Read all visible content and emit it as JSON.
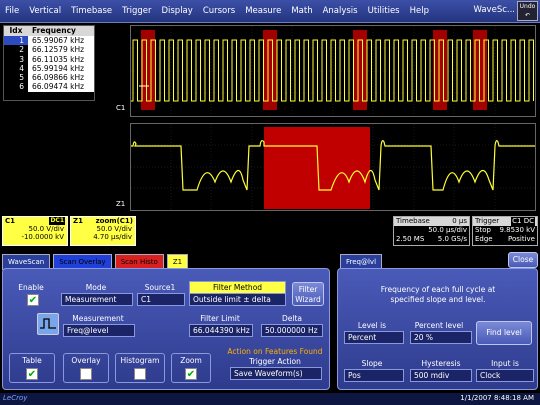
{
  "menu": {
    "items": [
      "File",
      "Vertical",
      "Timebase",
      "Trigger",
      "Display",
      "Cursors",
      "Measure",
      "Math",
      "Analysis",
      "Utilities",
      "Help"
    ],
    "brand": "WaveSc...",
    "undo_label": "Undo"
  },
  "freq_table": {
    "headers": {
      "idx": "Idx",
      "freq": "Frequency"
    },
    "rows": [
      {
        "idx": "1",
        "freq": "65.99067 kHz"
      },
      {
        "idx": "2",
        "freq": "66.12579 kHz"
      },
      {
        "idx": "3",
        "freq": "66.11035 kHz"
      },
      {
        "idx": "4",
        "freq": "65.99194 kHz"
      },
      {
        "idx": "5",
        "freq": "66.09866 kHz"
      },
      {
        "idx": "6",
        "freq": "66.09474 kHz"
      }
    ]
  },
  "traces": {
    "c1_label": "C1",
    "z1_label": "Z1"
  },
  "c1_box": {
    "title": "C1",
    "badge": "DC1",
    "line1": "50.0 V/div",
    "line2": "-10.0000 kV"
  },
  "z1_box": {
    "title": "Z1",
    "name": "zoom(C1)",
    "line1": "50.0 V/div",
    "line2": "4.70 µs/div"
  },
  "timebase_box": {
    "title": "Timebase",
    "delay": "0 µs",
    "line1_left": "",
    "line1_right": "50.0 µs/div",
    "line2_left": "2.50 MS",
    "line2_right": "5.0 GS/s"
  },
  "trigger_box": {
    "title": "Trigger",
    "badge": "C1 DC",
    "line1_left": "Stop",
    "line1_right": "9.8530 kV",
    "line2_left": "Edge",
    "line2_right": "Positive"
  },
  "tabs": [
    "WaveScan",
    "Scan Overlay",
    "Scan Histo",
    "Z1"
  ],
  "wavescan": {
    "enable_label": "Enable",
    "mode_label": "Mode",
    "mode_value": "Measurement",
    "source_label": "Source1",
    "source_value": "C1",
    "filter_method_label": "Filter Method",
    "filter_method_value": "Outside limit ± delta",
    "filter_wizard_label1": "Filter",
    "filter_wizard_label2": "Wizard",
    "measurement_label": "Measurement",
    "measurement_value": "Freq@level",
    "filter_limit_label": "Filter Limit",
    "filter_limit_value": "66.044390 kHz",
    "delta_label": "Delta",
    "delta_value": "50.000000 Hz",
    "action_found_label": "Action on Features Found",
    "trigger_action_label": "Trigger Action",
    "trigger_action_value": "Save Waveform(s)",
    "table_label": "Table",
    "overlay_label": "Overlay",
    "histogram_label": "Histogram",
    "zoom_label": "Zoom",
    "checked": {
      "enable": true,
      "table": true,
      "overlay": false,
      "histogram": false,
      "zoom": true
    }
  },
  "freq_panel": {
    "tab_label": "Freq@lvl",
    "close_label": "Close",
    "description_line1": "Frequency of each full cycle at",
    "description_line2": "specified slope and level.",
    "level_is_label": "Level is",
    "level_is_value": "Percent",
    "percent_level_label": "Percent level",
    "percent_level_value": "20 %",
    "find_level_label": "Find level",
    "slope_label": "Slope",
    "slope_value": "Pos",
    "hysteresis_label": "Hysteresis",
    "hysteresis_value": "500 mdiv",
    "input_is_label": "Input is",
    "input_is_value": "Clock"
  },
  "status": {
    "brand": "LeCroy",
    "datetime": "1/1/2007 8:48:18 AM"
  },
  "colors": {
    "trace": "#ffff33",
    "highlight": "#c00000",
    "panel": "#3d4ca8"
  }
}
